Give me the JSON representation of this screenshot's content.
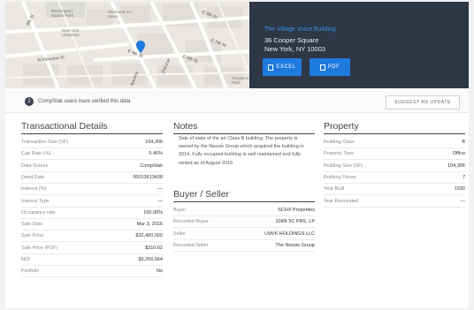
{
  "map": {
    "labels": [
      {
        "text": "Washington\nSquare Park",
        "name": "map-label-washington-square"
      },
      {
        "text": "Stenhardt Inc\nMusic",
        "name": "map-label-steinhardt"
      },
      {
        "text": "New York\nUniversity",
        "name": "map-label-nyu"
      },
      {
        "text": "Tompkins Sq\nPark",
        "name": "map-label-tompkins"
      }
    ],
    "streets": [
      {
        "text": "6th St",
        "name": "street-label-6th"
      },
      {
        "text": "W Houston St",
        "name": "street-label-houston"
      },
      {
        "text": "E 4th St",
        "name": "street-label-e4th"
      },
      {
        "text": "2nd Ave",
        "name": "street-label-2nd-ave"
      },
      {
        "text": "E 7th St",
        "name": "street-label-e7th"
      },
      {
        "text": "E 5th St",
        "name": "street-label-e5th"
      },
      {
        "text": "E 9th St",
        "name": "street-label-e9th"
      },
      {
        "text": "Bowery",
        "name": "street-label-bowery"
      }
    ]
  },
  "header": {
    "title": "The Village Voice Building",
    "address_line1": "36 Cooper Square",
    "address_line2": "New York, NY 10003",
    "excel_label": "EXCEL",
    "pdf_label": "PDF"
  },
  "verify": {
    "count": "2",
    "text": "CompStak users have verified this data",
    "suggest_label": "SUGGEST AN UPDATE"
  },
  "transactional": {
    "title": "Transactional Details",
    "rows": [
      {
        "k": "Transaction Size (SF)",
        "v": "104,306"
      },
      {
        "k": "Cap Rate (%)",
        "v": "5.40%"
      },
      {
        "k": "Data Source",
        "v": "CompStak"
      },
      {
        "k": "Deed Date",
        "v": "00013613438"
      },
      {
        "k": "Interest (%)",
        "v": "—"
      },
      {
        "k": "Interest Type",
        "v": "—"
      },
      {
        "k": "Occupancy rate",
        "v": "100.00%"
      },
      {
        "k": "Sale Date",
        "v": "Mar 3, 2016"
      },
      {
        "k": "Sale Price",
        "v": "$32,400,000"
      },
      {
        "k": "Sale Price (PSF)",
        "v": "$310.62"
      },
      {
        "k": "NOI",
        "v": "$3,256,564"
      },
      {
        "k": "Portfolio",
        "v": "No"
      }
    ]
  },
  "notes": {
    "title": "Notes",
    "text": "Sale of state of the art Class B building. The property is owned by the Nessie Group which acquired the building in 2014. Fully occupied building is well maintained and fully rented as of August 2016."
  },
  "buyer_seller": {
    "title": "Buyer / Seller",
    "rows": [
      {
        "k": "Buyer",
        "v": "SCHX Properties"
      },
      {
        "k": "Recorded Buyer",
        "v": "10KB 5C PRS, LP"
      },
      {
        "k": "Seller",
        "v": "LMVK HOLDINGS LLC"
      },
      {
        "k": "Recorded Seller",
        "v": "The Nessie Group"
      }
    ]
  },
  "property": {
    "title": "Property",
    "rows": [
      {
        "k": "Building Class",
        "v": "B"
      },
      {
        "k": "Property Type",
        "v": "Office"
      },
      {
        "k": "Building Size (SF)",
        "v": "104,306"
      },
      {
        "k": "Building Floors",
        "v": "7"
      },
      {
        "k": "Year Built",
        "v": "1930"
      },
      {
        "k": "Year Renovated",
        "v": "—"
      }
    ]
  }
}
